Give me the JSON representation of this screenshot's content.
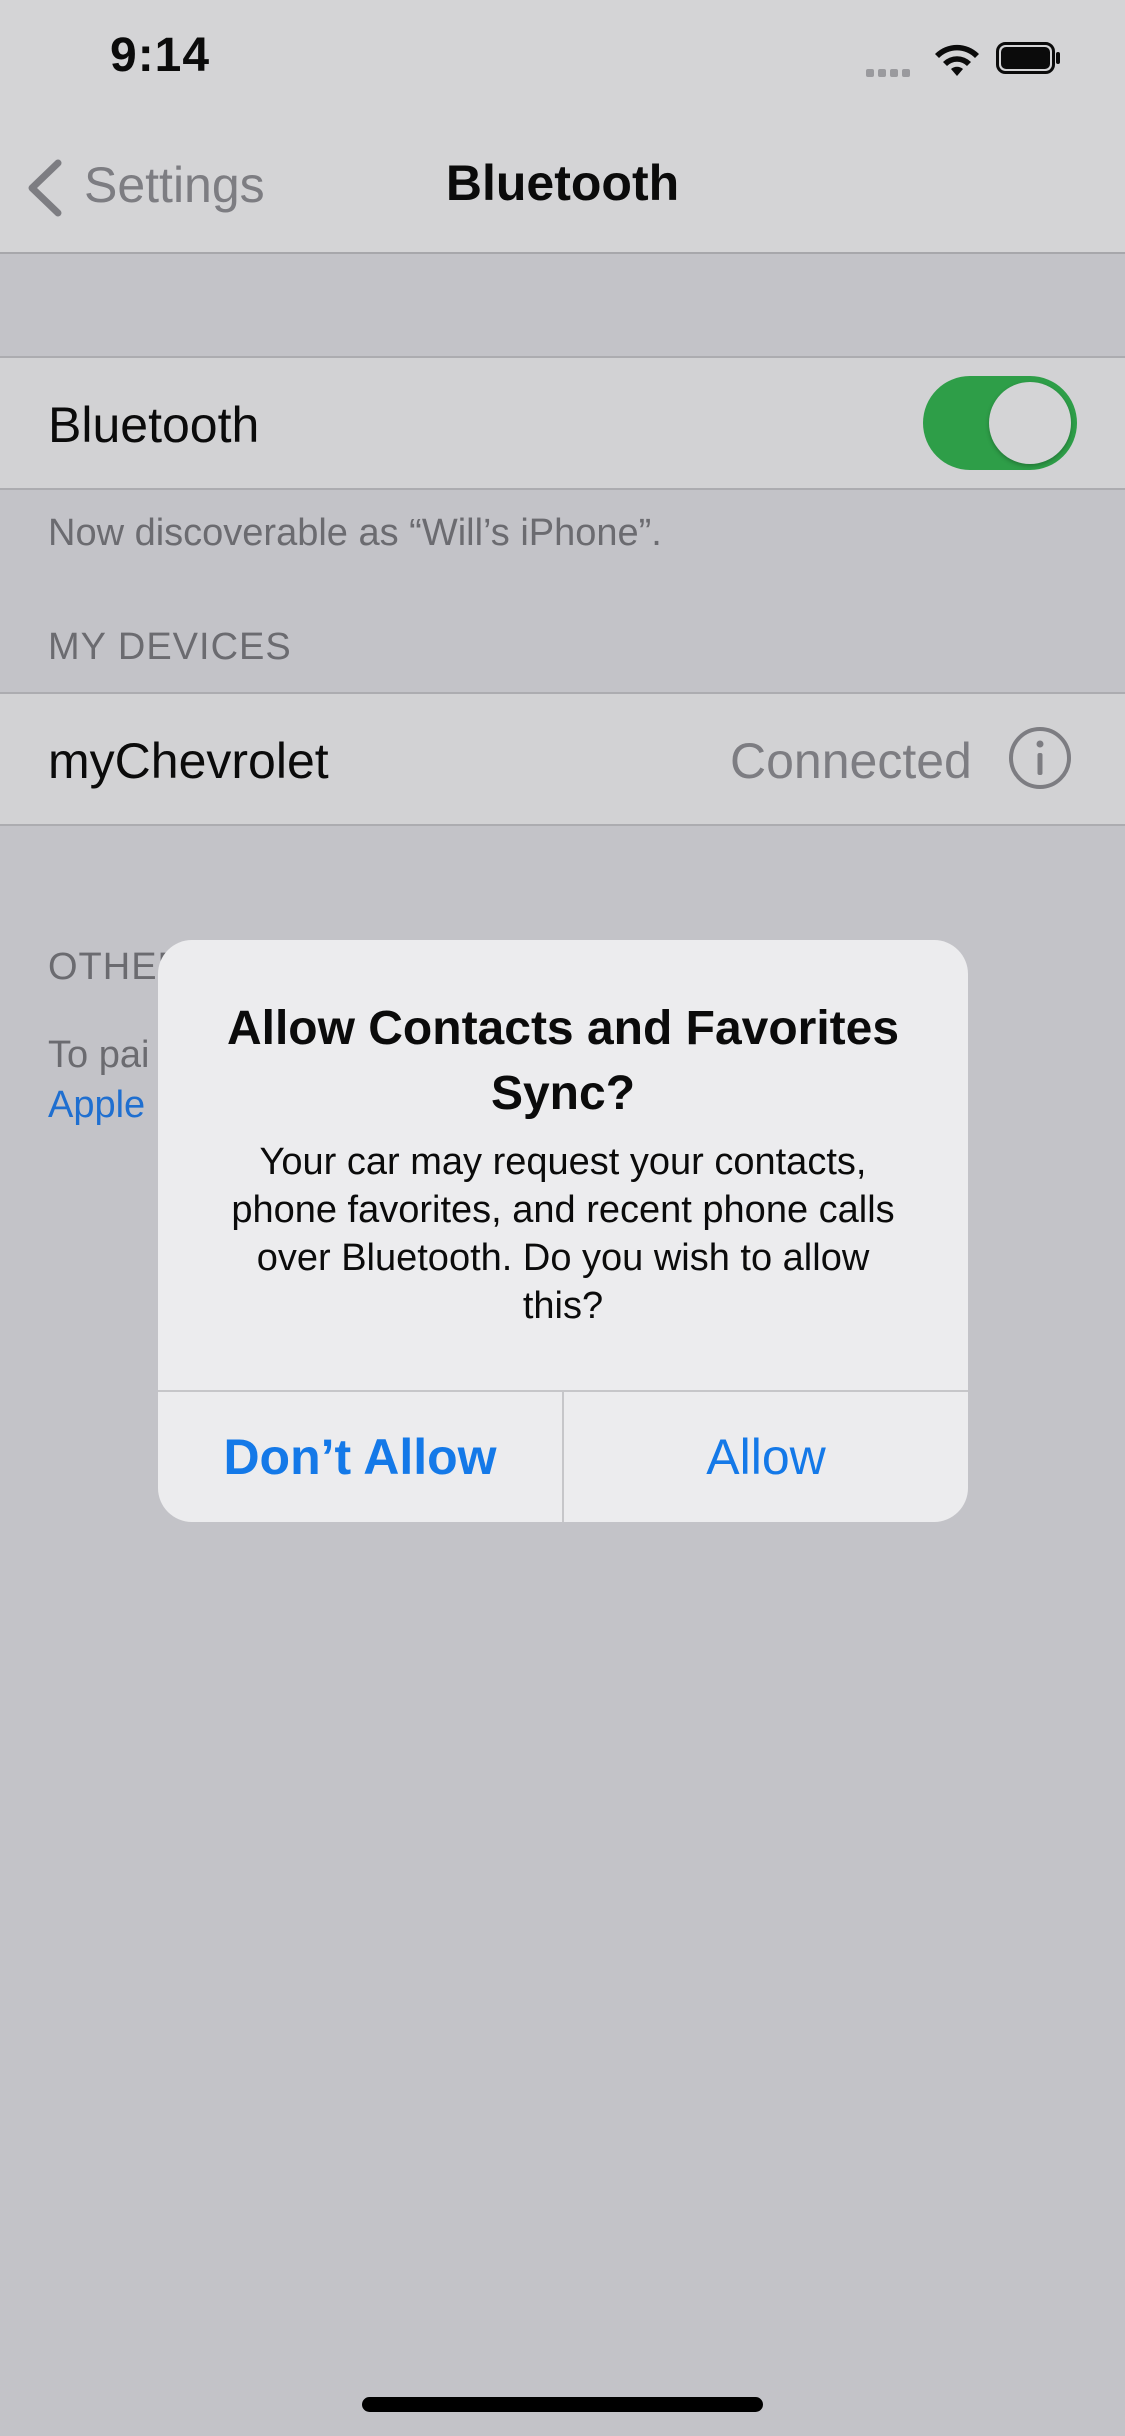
{
  "status_bar": {
    "time": "9:14"
  },
  "nav": {
    "back_label": "Settings",
    "title": "Bluetooth"
  },
  "bluetooth": {
    "label": "Bluetooth",
    "enabled": true,
    "discoverable_text": "Now discoverable as “Will’s iPhone”."
  },
  "my_devices": {
    "header": "MY DEVICES",
    "devices": [
      {
        "name": "myChevrolet",
        "status": "Connected"
      }
    ]
  },
  "other_devices": {
    "header_partial": "OTHER",
    "note_partial": "To pai",
    "link_partial": "Apple"
  },
  "alert": {
    "title": "Allow Contacts and Favorites Sync?",
    "message": "Your car may request your contacts, phone favorites, and recent phone calls over Bluetooth. Do you wish to allow this?",
    "dont_allow_label": "Don’t Allow",
    "allow_label": "Allow"
  },
  "colors": {
    "toggle_on": "#2e9e48",
    "alert_button": "#1479e8",
    "link": "#1f6fd0"
  }
}
